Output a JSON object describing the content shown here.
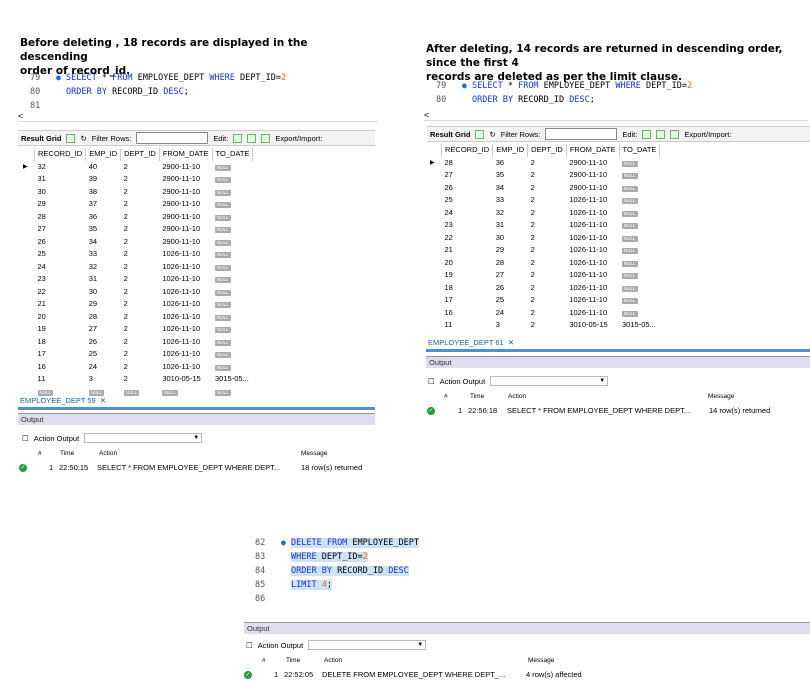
{
  "panel1": {
    "heading_line1": "Before deleting , 18 records are displayed in the descending",
    "heading_line2": "order of record_id.",
    "code_lines": [
      {
        "num": "79",
        "parts": [
          {
            "t": "SELECT ",
            "c": "kw"
          },
          {
            "t": "* ",
            "c": ""
          },
          {
            "t": "FROM ",
            "c": "kw"
          },
          {
            "t": "EMPLOYEE_DEPT ",
            "c": ""
          },
          {
            "t": "WHERE ",
            "c": "kw"
          },
          {
            "t": "DEPT_ID=",
            "c": ""
          },
          {
            "t": "2",
            "c": "num"
          }
        ]
      },
      {
        "num": "80",
        "parts": [
          {
            "t": "ORDER BY ",
            "c": "kw"
          },
          {
            "t": "RECORD_ID ",
            "c": ""
          },
          {
            "t": "DESC",
            "c": "kw"
          },
          {
            "t": ";",
            "c": ""
          }
        ]
      },
      {
        "num": "81",
        "parts": []
      }
    ],
    "toolbar": {
      "result_grid": "Result Grid",
      "filter_rows": "Filter Rows:",
      "edit": "Edit:",
      "export_import": "Export/Import:"
    },
    "columns": [
      "RECORD_ID",
      "EMP_ID",
      "DEPT_ID",
      "FROM_DATE",
      "TO_DATE"
    ],
    "rows": [
      [
        "32",
        "40",
        "2",
        "2900-11-10",
        "NULL"
      ],
      [
        "31",
        "39",
        "2",
        "2900-11-10",
        "NULL"
      ],
      [
        "30",
        "38",
        "2",
        "2900-11-10",
        "NULL"
      ],
      [
        "29",
        "37",
        "2",
        "2900-11-10",
        "NULL"
      ],
      [
        "28",
        "36",
        "2",
        "2900-11-10",
        "NULL"
      ],
      [
        "27",
        "35",
        "2",
        "2900-11-10",
        "NULL"
      ],
      [
        "26",
        "34",
        "2",
        "2900-11-10",
        "NULL"
      ],
      [
        "25",
        "33",
        "2",
        "1026-11-10",
        "NULL"
      ],
      [
        "24",
        "32",
        "2",
        "1026-11-10",
        "NULL"
      ],
      [
        "23",
        "31",
        "2",
        "1026-11-10",
        "NULL"
      ],
      [
        "22",
        "30",
        "2",
        "1026-11-10",
        "NULL"
      ],
      [
        "21",
        "29",
        "2",
        "1026-11-10",
        "NULL"
      ],
      [
        "20",
        "28",
        "2",
        "1026-11-10",
        "NULL"
      ],
      [
        "19",
        "27",
        "2",
        "1026-11-10",
        "NULL"
      ],
      [
        "18",
        "26",
        "2",
        "1026-11-10",
        "NULL"
      ],
      [
        "17",
        "25",
        "2",
        "1026-11-10",
        "NULL"
      ],
      [
        "16",
        "24",
        "2",
        "1026-11-10",
        "NULL"
      ],
      [
        "11",
        "3",
        "2",
        "3010-05-15",
        "3015-05..."
      ],
      [
        "NULL",
        "NULL",
        "NULL",
        "NULL",
        "NULL"
      ]
    ],
    "tab": "EMPLOYEE_DEPT 59",
    "output_label": "Output",
    "action_output": "Action Output",
    "log_headers": {
      "num": "#",
      "time": "Time",
      "action": "Action",
      "message": "Message"
    },
    "log": {
      "num": "1",
      "time": "22:50:15",
      "action": "SELECT * FROM EMPLOYEE_DEPT WHERE DEPT...",
      "message": "18 row(s) returned"
    }
  },
  "panel2": {
    "heading_line1": "After deleting, 14 records are returned in descending order, since the first 4",
    "heading_line2": "records are deleted as per the limit clause.",
    "code_lines": [
      {
        "num": "79",
        "parts": [
          {
            "t": "SELECT ",
            "c": "kw"
          },
          {
            "t": "* ",
            "c": ""
          },
          {
            "t": "FROM ",
            "c": "kw"
          },
          {
            "t": "EMPLOYEE_DEPT ",
            "c": ""
          },
          {
            "t": "WHERE ",
            "c": "kw"
          },
          {
            "t": "DEPT_ID=",
            "c": ""
          },
          {
            "t": "2",
            "c": "num"
          }
        ]
      },
      {
        "num": "80",
        "parts": [
          {
            "t": "ORDER BY ",
            "c": "kw"
          },
          {
            "t": "RECORD_ID ",
            "c": ""
          },
          {
            "t": "DESC",
            "c": "kw"
          },
          {
            "t": ";",
            "c": ""
          }
        ]
      }
    ],
    "toolbar": {
      "result_grid": "Result Grid",
      "filter_rows": "Filter Rows:",
      "edit": "Edit:",
      "export_import": "Export/Import:"
    },
    "columns": [
      "RECORD_ID",
      "EMP_ID",
      "DEPT_ID",
      "FROM_DATE",
      "TO_DATE"
    ],
    "rows": [
      [
        "28",
        "36",
        "2",
        "2900-11-10",
        "NULL"
      ],
      [
        "27",
        "35",
        "2",
        "2900-11-10",
        "NULL"
      ],
      [
        "26",
        "34",
        "2",
        "2900-11-10",
        "NULL"
      ],
      [
        "25",
        "33",
        "2",
        "1026-11-10",
        "NULL"
      ],
      [
        "24",
        "32",
        "2",
        "1026-11-10",
        "NULL"
      ],
      [
        "23",
        "31",
        "2",
        "1026-11-10",
        "NULL"
      ],
      [
        "22",
        "30",
        "2",
        "1026-11-10",
        "NULL"
      ],
      [
        "21",
        "29",
        "2",
        "1026-11-10",
        "NULL"
      ],
      [
        "20",
        "28",
        "2",
        "1026-11-10",
        "NULL"
      ],
      [
        "19",
        "27",
        "2",
        "1026-11-10",
        "NULL"
      ],
      [
        "18",
        "26",
        "2",
        "1026-11-10",
        "NULL"
      ],
      [
        "17",
        "25",
        "2",
        "1026-11-10",
        "NULL"
      ],
      [
        "16",
        "24",
        "2",
        "1026-11-10",
        "NULL"
      ],
      [
        "11",
        "3",
        "2",
        "3010-05-15",
        "3015-05..."
      ]
    ],
    "tab": "EMPLOYEE_DEPT 61",
    "output_label": "Output",
    "action_output": "Action Output",
    "log_headers": {
      "num": "#",
      "time": "Time",
      "action": "Action",
      "message": "Message"
    },
    "log": {
      "num": "1",
      "time": "22:56:18",
      "action": "SELECT * FROM EMPLOYEE_DEPT WHERE DEPT...",
      "message": "14 row(s) returned"
    }
  },
  "panel3": {
    "code_lines": [
      {
        "num": "82",
        "parts": [
          {
            "t": "DELETE ",
            "c": "kw"
          },
          {
            "t": "FROM ",
            "c": "kw"
          },
          {
            "t": "EMPLOYEE_DEPT",
            "c": ""
          }
        ]
      },
      {
        "num": "83",
        "parts": [
          {
            "t": "WHERE ",
            "c": "kw"
          },
          {
            "t": "DEPT_ID=",
            "c": ""
          },
          {
            "t": "2",
            "c": "num"
          }
        ]
      },
      {
        "num": "84",
        "parts": [
          {
            "t": "ORDER BY ",
            "c": "kw"
          },
          {
            "t": "RECORD_ID ",
            "c": ""
          },
          {
            "t": "DESC",
            "c": "kw"
          }
        ]
      },
      {
        "num": "85",
        "parts": [
          {
            "t": "LIMIT ",
            "c": "kw"
          },
          {
            "t": "4",
            "c": "num"
          },
          {
            "t": ";",
            "c": ""
          }
        ]
      },
      {
        "num": "86",
        "parts": []
      }
    ],
    "output_label": "Output",
    "action_output": "Action Output",
    "log_headers": {
      "num": "#",
      "time": "Time",
      "action": "Action",
      "message": "Message"
    },
    "log": {
      "num": "1",
      "time": "22:52:05",
      "action": "DELETE FROM EMPLOYEE_DEPT WHERE DEPT_...",
      "message": "4 row(s) affected"
    }
  },
  "colors": {
    "keyword": "#1535c8",
    "number": "#e07010",
    "accent": "#4f8fd8",
    "success": "#1e9e3a",
    "highlight": "#cde3f5"
  }
}
